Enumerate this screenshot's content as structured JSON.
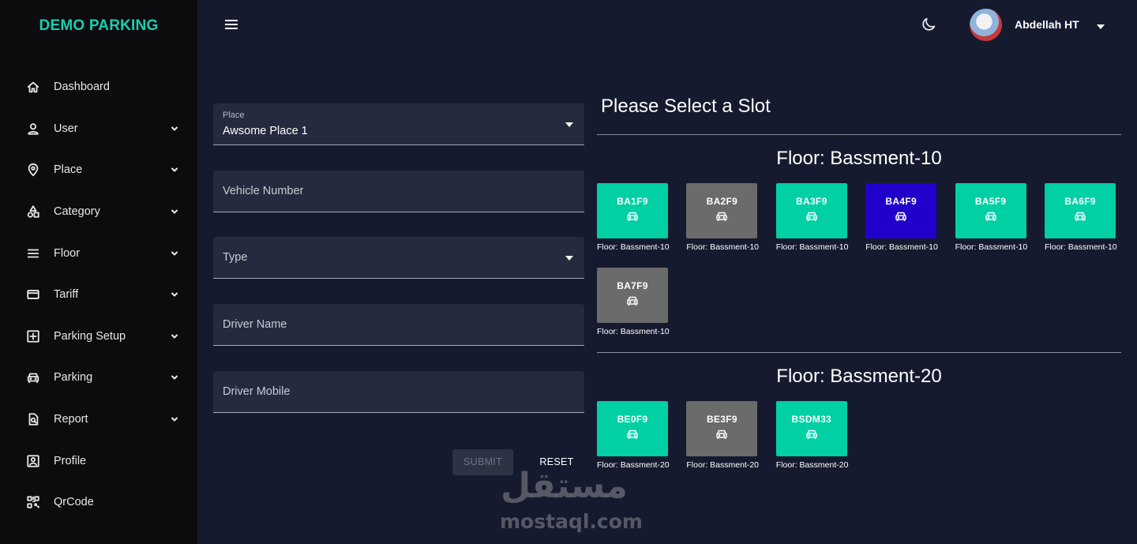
{
  "brand": "DEMO PARKING",
  "sidebar": {
    "items": [
      {
        "label": "Dashboard",
        "icon": "home-icon",
        "expandable": false
      },
      {
        "label": "User",
        "icon": "user-icon",
        "expandable": true
      },
      {
        "label": "Place",
        "icon": "map-pin-icon",
        "expandable": true
      },
      {
        "label": "Category",
        "icon": "category-icon",
        "expandable": true
      },
      {
        "label": "Floor",
        "icon": "layers-icon",
        "expandable": true
      },
      {
        "label": "Tariff",
        "icon": "credit-card-icon",
        "expandable": true
      },
      {
        "label": "Parking Setup",
        "icon": "plus-box-icon",
        "expandable": true
      },
      {
        "label": "Parking",
        "icon": "car-icon",
        "expandable": true
      },
      {
        "label": "Report",
        "icon": "report-icon",
        "expandable": true
      },
      {
        "label": "Profile",
        "icon": "profile-icon",
        "expandable": false
      },
      {
        "label": "QrCode",
        "icon": "qrcode-icon",
        "expandable": false
      }
    ]
  },
  "header": {
    "user_name": "Abdellah HT"
  },
  "form": {
    "place": {
      "label": "Place",
      "value": "Awsome Place 1"
    },
    "vehicle_number": {
      "placeholder": "Vehicle Number"
    },
    "type": {
      "placeholder": "Type"
    },
    "driver_name": {
      "placeholder": "Driver Name"
    },
    "driver_mobile": {
      "placeholder": "Driver Mobile"
    },
    "submit_label": "SUBMIT",
    "reset_label": "RESET"
  },
  "slots_panel": {
    "title": "Please Select a Slot",
    "floors": [
      {
        "title": "Floor: Bassment-10",
        "slots": [
          {
            "code": "BA1F9",
            "floor": "Floor: Bassment-10",
            "status": "available",
            "color": "#00d0a4"
          },
          {
            "code": "BA2F9",
            "floor": "Floor: Bassment-10",
            "status": "occupied",
            "color": "#6b6b6b"
          },
          {
            "code": "BA3F9",
            "floor": "Floor: Bassment-10",
            "status": "available",
            "color": "#00d0a4"
          },
          {
            "code": "BA4F9",
            "floor": "Floor: Bassment-10",
            "status": "selected",
            "color": "#2200cc"
          },
          {
            "code": "BA5F9",
            "floor": "Floor: Bassment-10",
            "status": "available",
            "color": "#00d0a4"
          },
          {
            "code": "BA6F9",
            "floor": "Floor: Bassment-10",
            "status": "available",
            "color": "#00d0a4"
          },
          {
            "code": "BA7F9",
            "floor": "Floor: Bassment-10",
            "status": "occupied",
            "color": "#6b6b6b"
          }
        ]
      },
      {
        "title": "Floor: Bassment-20",
        "slots": [
          {
            "code": "BE0F9",
            "floor": "Floor: Bassment-20",
            "status": "available",
            "color": "#00d0a4"
          },
          {
            "code": "BE3F9",
            "floor": "Floor: Bassment-20",
            "status": "occupied",
            "color": "#6b6b6b"
          },
          {
            "code": "BSDM33",
            "floor": "Floor: Bassment-20",
            "status": "available",
            "color": "#00d0a4"
          }
        ]
      }
    ]
  },
  "watermark": {
    "arabic": "مستقل",
    "latin": "mostaql.com"
  }
}
